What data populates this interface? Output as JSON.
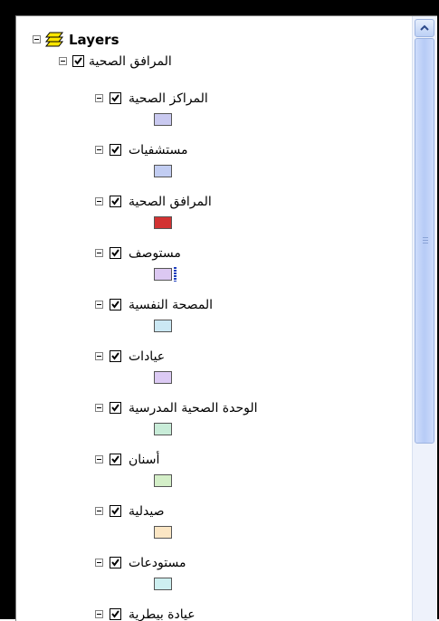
{
  "tree": {
    "root": {
      "label": "Layers",
      "icon": "layers-icon"
    },
    "group": {
      "label": "المرافق الصحية",
      "checked": true
    },
    "layers": [
      {
        "label": "المراكز الصحية",
        "checked": true,
        "swatch_color": "#c9c9f0"
      },
      {
        "label": "مستشفيات",
        "checked": true,
        "swatch_color": "#c2cdf2"
      },
      {
        "label": "المرافق الصحية",
        "checked": true,
        "swatch_color": "#d23232"
      },
      {
        "label": "مستوصف",
        "checked": true,
        "swatch_color": "#dcc8f2"
      },
      {
        "label": "المصحة النفسية",
        "checked": true,
        "swatch_color": "#cbe8f4"
      },
      {
        "label": "عيادات",
        "checked": true,
        "swatch_color": "#dccaf4"
      },
      {
        "label": "الوحدة الصحية المدرسية",
        "checked": true,
        "swatch_color": "#c8ecd8"
      },
      {
        "label": "أسنان",
        "checked": true,
        "swatch_color": "#d4efc8"
      },
      {
        "label": "صيدلية",
        "checked": true,
        "swatch_color": "#fbe6c4"
      },
      {
        "label": "مستودعات",
        "checked": true,
        "swatch_color": "#cdeff0"
      },
      {
        "label": "عيادة بيطرية",
        "checked": true,
        "swatch_color": "#d5eec8"
      }
    ]
  }
}
